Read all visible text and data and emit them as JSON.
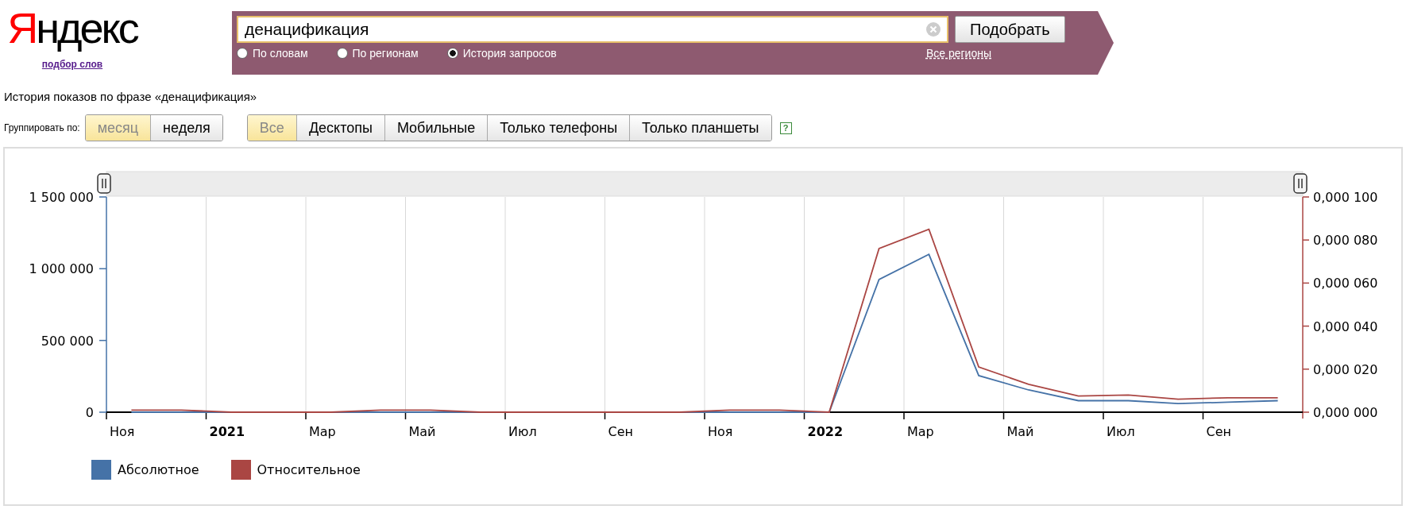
{
  "header": {
    "logo": "Яндекс",
    "logo_link": "подбор слов"
  },
  "search": {
    "value": "денацификация",
    "button": "Подобрать",
    "modes": [
      {
        "label": "По словам",
        "selected": false
      },
      {
        "label": "По регионам",
        "selected": false
      },
      {
        "label": "История запросов",
        "selected": true
      }
    ],
    "region_link": "Все регионы"
  },
  "heading": "История показов по фразе «денацификация»",
  "group_by": {
    "label": "Группировать по:",
    "options": [
      {
        "label": "месяц",
        "selected": true
      },
      {
        "label": "неделя",
        "selected": false
      }
    ]
  },
  "devices": [
    {
      "label": "Все",
      "selected": true
    },
    {
      "label": "Десктопы",
      "selected": false
    },
    {
      "label": "Мобильные",
      "selected": false
    },
    {
      "label": "Только телефоны",
      "selected": false
    },
    {
      "label": "Только планшеты",
      "selected": false
    }
  ],
  "help": "?",
  "chart": {
    "chart_data": {
      "type": "line",
      "categories": [
        "Ноя",
        null,
        "2021",
        null,
        "Мар",
        null,
        "Май",
        null,
        "Июл",
        null,
        "Сен",
        null,
        "Ноя",
        null,
        "2022",
        null,
        "Мар",
        null,
        "Май",
        null,
        "Июл",
        null,
        "Сен",
        null
      ],
      "ylim": [
        0,
        1500000
      ],
      "yticks": [
        {
          "value": 0,
          "label": "0"
        },
        {
          "value": 500000,
          "label": "500 000"
        },
        {
          "value": 1000000,
          "label": "1 000 000"
        },
        {
          "value": 1500000,
          "label": "1 500 000"
        }
      ],
      "y2lim": [
        0,
        0.0001
      ],
      "y2ticks": [
        {
          "value": 0,
          "label": "0,000 000"
        },
        {
          "value": 2e-05,
          "label": "0,000 020"
        },
        {
          "value": 4e-05,
          "label": "0,000 040"
        },
        {
          "value": 6e-05,
          "label": "0,000 060"
        },
        {
          "value": 8e-05,
          "label": "0,000 080"
        },
        {
          "value": 0.0001,
          "label": "0,000 100"
        }
      ],
      "series": [
        {
          "name": "Абсолютное",
          "color": "#4572a7",
          "values": [
            0,
            0,
            0,
            0,
            0,
            0,
            0,
            0,
            0,
            0,
            0,
            0,
            0,
            0,
            0,
            925000,
            1100000,
            255000,
            155000,
            80000,
            80000,
            60000,
            70000,
            80000
          ]
        },
        {
          "name": "Относительное",
          "color": "#aa4643",
          "axis": "y2",
          "values": [
            1e-06,
            1e-06,
            0,
            0,
            0,
            1e-06,
            1e-06,
            0,
            0,
            0,
            0,
            0,
            1e-06,
            1e-06,
            0,
            7.6e-05,
            8.5e-05,
            2.1e-05,
            1.3e-05,
            7.5e-06,
            8e-06,
            6e-06,
            6.7e-06,
            6.7e-06
          ]
        }
      ]
    }
  }
}
